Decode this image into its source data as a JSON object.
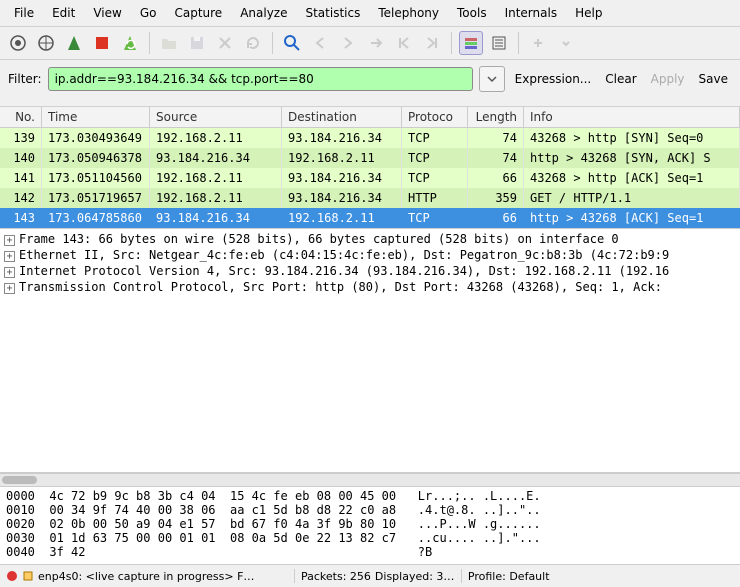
{
  "menu": [
    "File",
    "Edit",
    "View",
    "Go",
    "Capture",
    "Analyze",
    "Statistics",
    "Telephony",
    "Tools",
    "Internals",
    "Help"
  ],
  "filter": {
    "label": "Filter:",
    "value": "ip.addr==93.184.216.34 && tcp.port==80",
    "expression": "Expression...",
    "clear": "Clear",
    "apply": "Apply",
    "save": "Save"
  },
  "columns": {
    "no": "No.",
    "time": "Time",
    "src": "Source",
    "dst": "Destination",
    "proto": "Protoco",
    "len": "Length",
    "info": "Info"
  },
  "packets": [
    {
      "no": "139",
      "time": "173.030493649",
      "src": "192.168.2.11",
      "dst": "93.184.216.34",
      "proto": "TCP",
      "len": "74",
      "info": "43268 > http [SYN]  Seq=0",
      "cls": "g1"
    },
    {
      "no": "140",
      "time": "173.050946378",
      "src": "93.184.216.34",
      "dst": "192.168.2.11",
      "proto": "TCP",
      "len": "74",
      "info": "http > 43268 [SYN, ACK]  S",
      "cls": "g2"
    },
    {
      "no": "141",
      "time": "173.051104560",
      "src": "192.168.2.11",
      "dst": "93.184.216.34",
      "proto": "TCP",
      "len": "66",
      "info": "43268 > http [ACK]  Seq=1",
      "cls": "g1"
    },
    {
      "no": "142",
      "time": "173.051719657",
      "src": "192.168.2.11",
      "dst": "93.184.216.34",
      "proto": "HTTP",
      "len": "359",
      "info": "GET / HTTP/1.1",
      "cls": "g2"
    },
    {
      "no": "143",
      "time": "173.064785860",
      "src": "93.184.216.34",
      "dst": "192.168.2.11",
      "proto": "TCP",
      "len": "66",
      "info": "http > 43268 [ACK]  Seq=1",
      "cls": "sel"
    }
  ],
  "details": [
    "Frame 143: 66 bytes on wire (528 bits), 66 bytes captured (528 bits) on interface 0",
    "Ethernet II, Src: Netgear_4c:fe:eb (c4:04:15:4c:fe:eb), Dst: Pegatron_9c:b8:3b (4c:72:b9:9",
    "Internet Protocol Version 4, Src: 93.184.216.34 (93.184.216.34), Dst: 192.168.2.11 (192.16",
    "Transmission Control Protocol, Src Port: http (80), Dst Port: 43268 (43268), Seq: 1, Ack:"
  ],
  "hex": [
    {
      "off": "0000",
      "b": "4c 72 b9 9c b8 3b c4 04  15 4c fe eb 08 00 45 00",
      "a": "Lr...;.. .L....E."
    },
    {
      "off": "0010",
      "b": "00 34 9f 74 40 00 38 06  aa c1 5d b8 d8 22 c0 a8",
      "a": ".4.t@.8. ..]..\".."
    },
    {
      "off": "0020",
      "b": "02 0b 00 50 a9 04 e1 57  bd 67 f0 4a 3f 9b 80 10",
      "a": "...P...W .g......"
    },
    {
      "off": "0030",
      "b": "01 1d 63 75 00 00 01 01  08 0a 5d 0e 22 13 82 c7",
      "a": "..cu.... ..].\"..."
    },
    {
      "off": "0040",
      "b": "3f 42",
      "a": "?B"
    }
  ],
  "status": {
    "iface": "enp4s0: <live capture in progress> F…",
    "packets": "Packets: 256",
    "displayed": "Displayed: 3…",
    "profile": "Profile: Default"
  }
}
